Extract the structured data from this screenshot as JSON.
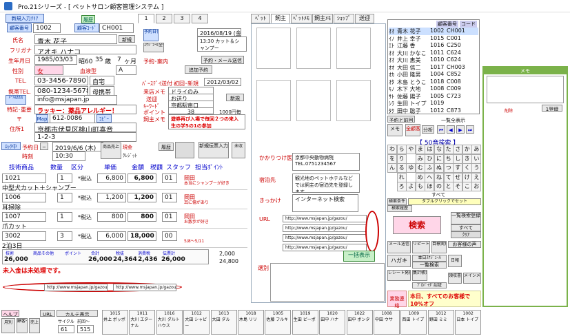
{
  "window": {
    "title": "Pro.21シリーズ   - [ ペットサロン顧客管理システム ]"
  },
  "header": {
    "new_customer_btn": "新規入力ｸﾘｱ",
    "customer_no_label": "顧客番号",
    "customer_no": "1002",
    "info_btn": "履歴",
    "customer_code_label": "顧客ｺｰﾄﾞ",
    "customer_code": "CH001",
    "page_tabs": [
      "1",
      "2",
      "3",
      "4"
    ]
  },
  "customer": {
    "name_label": "氏名",
    "name": "青木 花子",
    "furigana_label": "フリガナ",
    "furigana": "アオキ ハナコ",
    "dob_label": "生年月日",
    "dob": "1985/03/03",
    "era": "昭60",
    "age": "35",
    "age_unit": "歳",
    "months": "7",
    "months_unit": "ヶ月",
    "gender_label": "性別",
    "gender": "女",
    "blood_label": "血液型",
    "blood": "A",
    "tel_label": "TEL.",
    "tel": "03-3456-7890",
    "tel_type": "自宅",
    "mobile_label": "携帯TEL.",
    "mobile": "080-1234-5678",
    "mobile_type": "母携帯",
    "email": "info@msjapan.jp",
    "email_btn": "ﾒｰﾙ送信",
    "note_label": "特記･重要",
    "note": "ラッキー：薬品アレルギー！",
    "zip": "612-0086",
    "zip_btn": "ｺﾋﾟｰ",
    "address1_label": "住所1",
    "address1": "京都市伏見区桃山町喜音",
    "address2": "1-2-3",
    "hold_btn": "新規"
  },
  "reservation": {
    "date_label": "予約日",
    "tag_label": "ﾛｯｸ中",
    "date_value": "2019/6/6 (木)",
    "time_label": "時刻",
    "time_value": "10:30",
    "product_label": "商品売上",
    "cash_label": "現金",
    "credit_label": "ｸﾚｼﾞｯﾄ",
    "history_btn": "履歴",
    "new_entry_btn": "新規伝票入力",
    "unpaid_label": "未収"
  },
  "grid": {
    "headers": [
      "技術商品",
      "数量",
      "区分",
      "単価",
      "金額",
      "税額",
      "スタッフ",
      "担当ﾎﾟｲﾝﾄ"
    ],
    "rows": [
      {
        "code": "1021",
        "name": "中型犬カット＋シャンプー",
        "qty": "1",
        "tax": "*税込",
        "price": "6,800",
        "amount": "6,800",
        "staff": "01",
        "staff_name": "岡田",
        "memo": "本当にシャンプーが好き"
      },
      {
        "code": "1006",
        "name": "耳掃除",
        "qty": "1",
        "tax": "*税込",
        "price": "1,200",
        "amount": "1,200",
        "staff": "01",
        "staff_name": "岡田",
        "memo": "耳に傷があり"
      },
      {
        "code": "1007",
        "name": "爪カット",
        "qty": "1",
        "tax": "*税込",
        "price": "800",
        "amount": "800",
        "staff": "01",
        "staff_name": "岡田",
        "memo": "お散歩が好き"
      },
      {
        "code": "3002",
        "name": "2泊3日",
        "qty": "3",
        "tax": "*税込",
        "price": "6,000",
        "amount": "18,000",
        "staff": "00",
        "staff_name": "",
        "memo": "5/8〜5/11"
      }
    ],
    "totals_headers": [
      "技術",
      "商品その他",
      "ポイント",
      "合計",
      "税抜",
      "消費税",
      "伝票計"
    ],
    "totals": [
      "26,000",
      "",
      "",
      "26,000",
      "24,364",
      "2,436",
      "26,000"
    ],
    "cash_total": "24,800",
    "change_label": "2,000",
    "status_text": "未入金は未処理です。"
  },
  "middle": {
    "reservation_label": "予約日付",
    "reservation_date": "2016/08/19 (金)",
    "reservation_detail": "13:30 カット＆シャンプー",
    "schedule_btn": "ｽｹｼﾞｭｰﾙ全体",
    "mail_btn": "予約・メール送信",
    "add_btn": "追加予約",
    "notice_label": "予約･案内",
    "birthday_label": "ﾊﾞｰｽﾃﾞｲ送付",
    "birthday_date": "2012/03/02",
    "first_label": "初回･新規",
    "memo_label": "来店メモ",
    "memo1": "ドライのみ",
    "pickup_label": "送迎",
    "pickup": "お送り",
    "pickup_place": "京都駅南口",
    "new_btn": "新規",
    "keyword_label": "ｷｰﾜｰﾄﾞ",
    "points_label": "ポイント",
    "points": "38",
    "point_unit": "1000円毎",
    "owner_memo_label": "飼主メモ",
    "owner_memo": "遊券再び入場で毎回２つの来入生の学5の1の参加"
  },
  "pettabs": [
    "ﾍﾟｯﾄ",
    "飼主",
    "ﾍﾟｯﾄﾒﾓ",
    "飼主ﾒﾓ",
    "ｼｮｯﾌﾟ",
    "送迎"
  ],
  "clinic": {
    "clinic_label": "かかりつけ医",
    "clinic_name": "京都中央動物病院",
    "clinic_tel": "TEL.0751234567",
    "boarding_label": "宿泊先",
    "boarding": "観光地のペットホテルなどでは飼主の宿泊先を登録します。",
    "trigger_label": "きっかけ",
    "trigger": "インターネット検索",
    "url_label": "URL",
    "urls": [
      "http://www.msjapan.jp/gazou/",
      "http://www.msjapan.jp/gazou/",
      "http://www.msjapan.jp/gazou/",
      "http://www.msjapan.jp/gazou/"
    ],
    "batch_btn": "一括表示",
    "relation_label": "選別"
  },
  "customer_list": {
    "header_code": "顧客番号",
    "header_code2": "コード",
    "rows": [
      {
        "kana": "ｵｵ",
        "name": "青木 花子",
        "no": "1002",
        "code": "CH001"
      },
      {
        "kana": "ｲﾉ",
        "name": "井上 幸子",
        "no": "1015",
        "code": "C001"
      },
      {
        "kana": "ｴﾄ",
        "name": "江藤 香",
        "no": "1016",
        "code": "C250"
      },
      {
        "kana": "ｵｵ",
        "name": "大川 かなこ",
        "no": "1011",
        "code": "C624"
      },
      {
        "kana": "ｵｵ",
        "name": "大川 恵美",
        "no": "1010",
        "code": "C624"
      },
      {
        "kana": "ｵｵ",
        "name": "大田 信二",
        "no": "1017",
        "code": "CH003"
      },
      {
        "kana": "ｵｶ",
        "name": "小田 隆男",
        "no": "1004",
        "code": "C852"
      },
      {
        "kana": "ｵﾀ",
        "name": "木島 とうこ",
        "no": "1018",
        "code": "C008"
      },
      {
        "kana": "ｷﾉ",
        "name": "木下 大地",
        "no": "1008",
        "code": "C009"
      },
      {
        "kana": "ｻﾄ",
        "name": "佐藤 陽子",
        "no": "1005",
        "code": "C723"
      },
      {
        "kana": "ｼﾗ",
        "name": "生田 トイプ",
        "no": "1019",
        "code": ""
      },
      {
        "kana": "ﾀｸ",
        "name": "田中 聡子",
        "no": "1012",
        "code": "C873"
      }
    ],
    "prev_label": "予約と前回",
    "list_all": "一覧全表示"
  },
  "search": {
    "memo_btn": "メモ",
    "all_customers": "全顧客",
    "analysis": "分析",
    "kana_title": "【 50音検索 】",
    "kana_rows": [
      [
        "わ",
        "ら",
        "や",
        "ま",
        "は",
        "な",
        "た",
        "さ",
        "か",
        "あ"
      ],
      [
        "を",
        "り",
        "",
        "み",
        "ひ",
        "に",
        "ち",
        "し",
        "き",
        "い"
      ],
      [
        "ん",
        "る",
        "ゆ",
        "む",
        "ふ",
        "ぬ",
        "つ",
        "す",
        "く",
        "う"
      ],
      [
        "",
        "れ",
        "",
        "め",
        "へ",
        "ね",
        "て",
        "せ",
        "け",
        "え"
      ],
      [
        "",
        "ろ",
        "よ",
        "も",
        "ほ",
        "の",
        "と",
        "そ",
        "こ",
        "お"
      ]
    ],
    "all_label": "すべて",
    "search_setting": "検索条件",
    "double_click": "ダブルクリックでセット",
    "search_history": "検索履歴",
    "search_btn": "検索",
    "bulk_btn": "一覧検索登録",
    "all_btn": "すべて",
    "clear_btn": "ｸﾘｱ"
  },
  "right_buttons": {
    "mail_send": "メール送信",
    "repeat": "リピート分析",
    "goal": "目標実績",
    "voice": "お客様の声",
    "postcard": "ハガキ",
    "schedule": "本日ｽｹｼﾞｭｰﾙ",
    "schedule_list": "一覧検索",
    "receipt": "レシート発行",
    "report": "集計帳票",
    "daily": "日報",
    "receipt2": "領収書",
    "menu": "メインメニューへ",
    "auth": "ﾌﾟﾛﾊﾞｲﾀﾞ認証",
    "notice_title": "業務連絡",
    "notice": "本日、すべてのお客様で10%オフ",
    "memo_title": "メモ",
    "delete_btn": "削除",
    "list_btn": "1登録"
  },
  "bottom": {
    "help": "ヘルプ",
    "url": "URL",
    "card": "カルテ表示",
    "month": "月別",
    "customer_list": "顧客一覧",
    "sales": "売上",
    "sales_list": "売上一覧",
    "cycle": "サイクル",
    "cycle_value": "61",
    "prev": "前回〜",
    "prev_value": "515",
    "cells": [
      {
        "code": "1015",
        "name": "井上 ポッポ"
      },
      {
        "code": "1011",
        "name": "大川 エターナル"
      },
      {
        "code": "1016",
        "name": "大川 ダルトハウス"
      },
      {
        "code": "1012",
        "name": "大田 シャピー"
      },
      {
        "code": "1013",
        "name": "大田 ダル"
      },
      {
        "code": "1018",
        "name": "木島 リリ"
      },
      {
        "code": "1005",
        "name": "佐藤 フルキ"
      },
      {
        "code": "1019",
        "name": "生田 ピーポ"
      },
      {
        "code": "1020",
        "name": "田中 ハナ"
      },
      {
        "code": "1022",
        "name": "田中 ボンタ"
      },
      {
        "code": "1008",
        "name": "中田 ウサ"
      },
      {
        "code": "1009",
        "name": "西田 トイプ"
      },
      {
        "code": "1012",
        "name": "野田 ミミ"
      },
      {
        "code": "1002",
        "name": "日本 トイプ"
      }
    ]
  },
  "colors": {
    "accent": "#2b6cc4",
    "alert": "#d00000",
    "green": "#7bb24a"
  }
}
